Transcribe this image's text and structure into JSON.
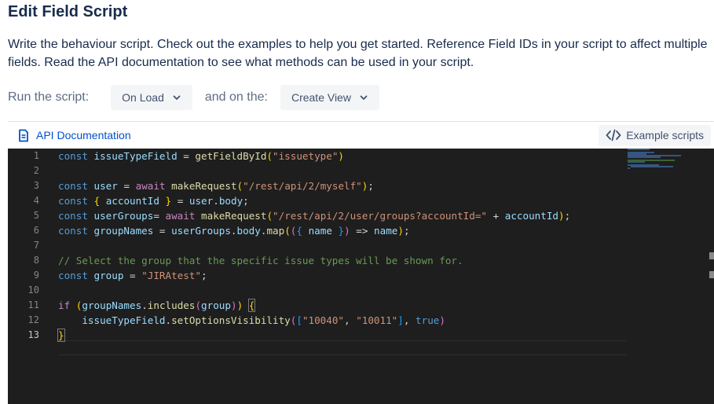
{
  "page": {
    "title": "Edit Field Script",
    "description": "Write the behaviour script. Check out the examples to help you get started. Reference Field IDs in your script to affect multiple fields. Read the API documentation to see what methods can be used in your script."
  },
  "run_row": {
    "label": "Run the script:",
    "trigger_value": "On Load",
    "mid_label": "and on the:",
    "view_value": "Create View"
  },
  "toolbar": {
    "api_label": "API Documentation",
    "examples_label": "Example scripts"
  },
  "icons": {
    "api": "document-icon",
    "examples": "code-icon",
    "chevron": "chevron-down-icon"
  },
  "colors": {
    "accent": "#0052cc",
    "editor_bg": "#1e1e1e"
  },
  "editor": {
    "line_numbers": [
      "1",
      "2",
      "3",
      "4",
      "5",
      "6",
      "7",
      "8",
      "9",
      "10",
      "11",
      "12",
      "13"
    ],
    "active_line": "13"
  }
}
